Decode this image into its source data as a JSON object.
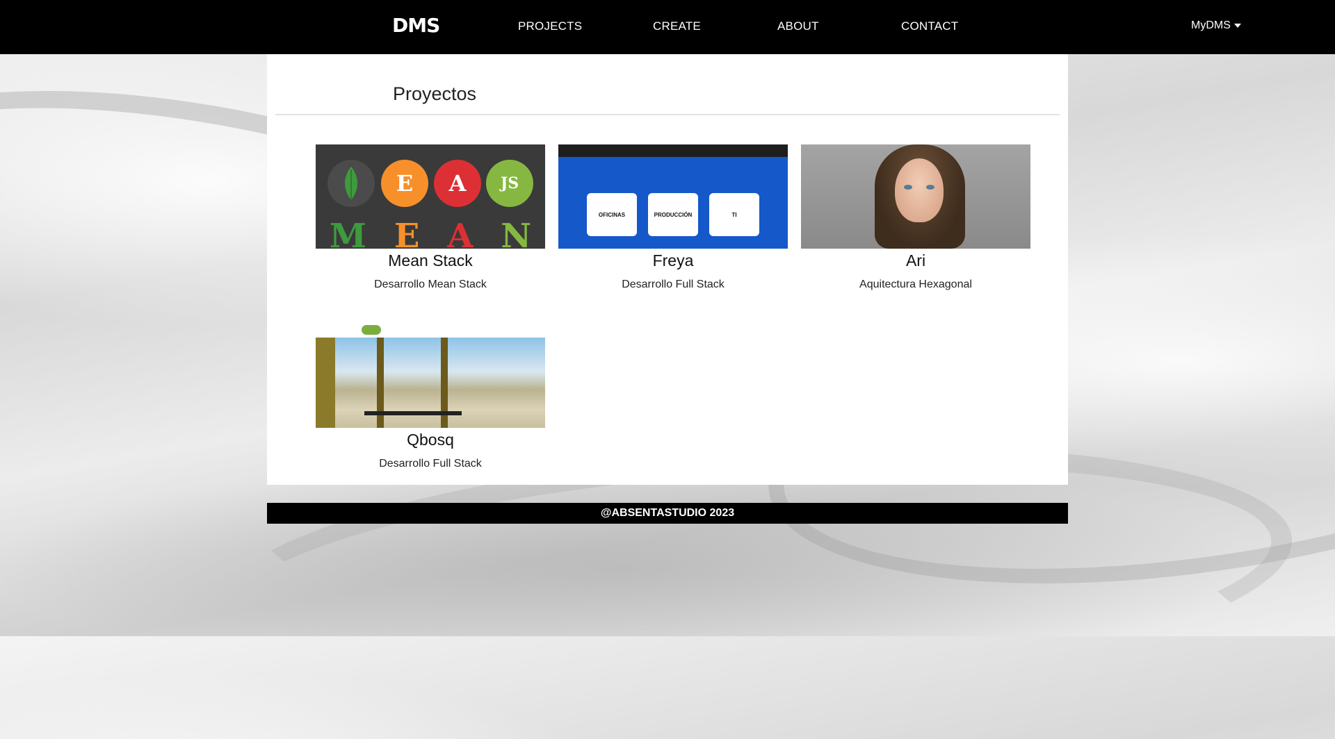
{
  "navbar": {
    "brand": "DMS",
    "links": [
      "PROJECTS",
      "CREATE",
      "ABOUT",
      "CONTACT"
    ],
    "user_menu": "MyDMS"
  },
  "main": {
    "title": "Proyectos",
    "projects": [
      {
        "title": "Mean Stack",
        "description": "Desarrollo Mean Stack",
        "thumb_letters": [
          "M",
          "E",
          "A",
          "N"
        ],
        "thumb_icons": [
          "E",
          "A",
          "JS"
        ]
      },
      {
        "title": "Freya",
        "description": "Desarrollo Full Stack",
        "thumb_tiles": [
          "OFICINAS",
          "PRODUCCIÓN",
          "TI"
        ]
      },
      {
        "title": "Ari",
        "description": "Aquitectura Hexagonal"
      },
      {
        "title": "Qbosq",
        "description": "Desarrollo Full Stack"
      }
    ]
  },
  "footer": {
    "text": "@ABSENTASTUDIO 2023"
  },
  "colors": {
    "navbar": "#000000",
    "panel": "#ffffff",
    "mean_green": "#3f9a3f",
    "mean_orange": "#f7902a",
    "mean_red": "#dd3034",
    "mean_lime": "#86b841",
    "freya_blue": "#1558c9"
  }
}
